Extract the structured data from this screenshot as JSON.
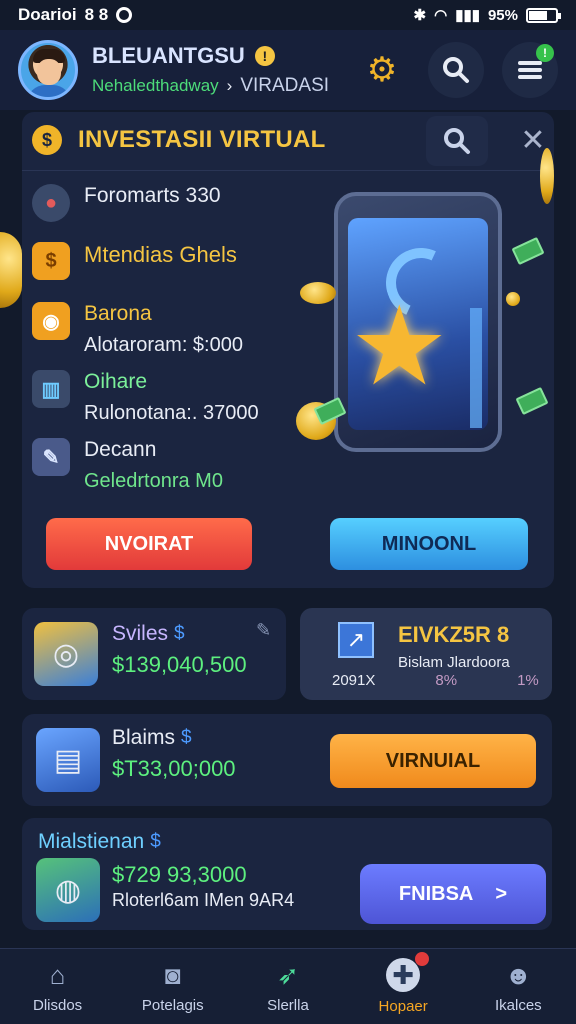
{
  "status_bar": {
    "carrier": "Doarioi",
    "time_digits": "8 8",
    "battery": "95%"
  },
  "header": {
    "user_name": "BLEUANTGSU",
    "user_sub_green": "Nehaledthadway",
    "user_sub_white": "VIRADASI",
    "notif_count": "!",
    "icons": [
      "gear-icon",
      "search-icon",
      "menu-icon"
    ]
  },
  "invest_card": {
    "title": "INVESTASII VIRTUAL",
    "rows": [
      {
        "title": "Foromarts 330",
        "title_color": "#e8ecf5"
      },
      {
        "title": "Mtendias Ghels",
        "title_color": "#f5c542"
      },
      {
        "title": "Barona",
        "title_color": "#f5c542",
        "sub": "Alotaroram: $:000"
      },
      {
        "title": "Oihare",
        "title_color": "#7cf09a",
        "sub": "Rulonotana:. 37000"
      },
      {
        "title": "Decann",
        "title_color": "#e8ecf5",
        "sub": "Geledrtonra M0",
        "sub_color": "#6fe58c"
      }
    ],
    "btn_left": "NVOIRAT",
    "btn_right": "MINOONL"
  },
  "cards": {
    "card1": {
      "title": "Sviles",
      "value": "$139,040,500"
    },
    "card2": {
      "title": "EIVKZ5R 8",
      "sub": "Bislam Jlardoora",
      "foot_left": "2091X",
      "foot_mid": "8%",
      "foot_right": "1%"
    },
    "card3": {
      "title": "Blaims",
      "value": "$T33,00;000",
      "button": "VIRNUIAL"
    },
    "card4": {
      "title": "Mialstienan",
      "value": "$729 93,3000",
      "sub": "Rloterl6am IMen 9AR4",
      "button": "FNIBSA",
      "button_arrow": ">"
    }
  },
  "bottom_nav": [
    {
      "label": "Dlisdos",
      "icon": "home-icon"
    },
    {
      "label": "Potelagis",
      "icon": "camera-icon"
    },
    {
      "label": "Slerlla",
      "icon": "compass-icon"
    },
    {
      "label": "Hopaer",
      "icon": "joystick-icon",
      "active": true
    },
    {
      "label": "Ikalces",
      "icon": "person-icon"
    }
  ]
}
